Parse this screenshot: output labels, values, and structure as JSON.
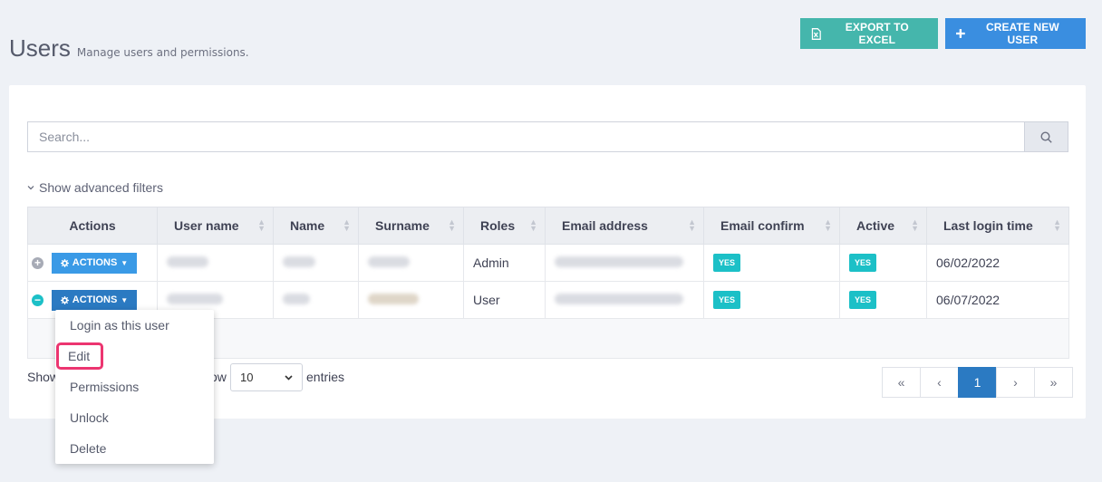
{
  "header": {
    "title": "Users",
    "subtitle": "Manage users and permissions.",
    "export_label": "EXPORT TO EXCEL",
    "create_label": "CREATE NEW USER"
  },
  "search": {
    "placeholder": "Search..."
  },
  "filters": {
    "toggle_label": "Show advanced filters"
  },
  "table": {
    "columns": [
      "Actions",
      "User name",
      "Name",
      "Surname",
      "Roles",
      "Email address",
      "Email confirm",
      "Active",
      "Last login time"
    ],
    "rows": [
      {
        "action_label": "ACTIONS",
        "role": "Admin",
        "email_confirm": "YES",
        "active": "YES",
        "last_login": "06/02/2022"
      },
      {
        "action_label": "ACTIONS",
        "role": "User",
        "email_confirm": "YES",
        "active": "YES",
        "last_login": "06/07/2022"
      }
    ]
  },
  "footer": {
    "show_prefix": "Show",
    "show_mid": "ow",
    "page_size": "10",
    "entries_label": "entries",
    "pager": [
      "«",
      "‹",
      "1",
      "›",
      "»"
    ]
  },
  "dropdown": {
    "items": [
      "Login as this user",
      "Edit",
      "Permissions",
      "Unlock",
      "Delete"
    ]
  },
  "colors": {
    "excel": "#45b6ac",
    "create": "#3a8ee0",
    "actions_button": "#3a9ae6",
    "badge": "#1cc0c7",
    "active_page": "#2b7ac2",
    "highlight": "#ec3570"
  }
}
